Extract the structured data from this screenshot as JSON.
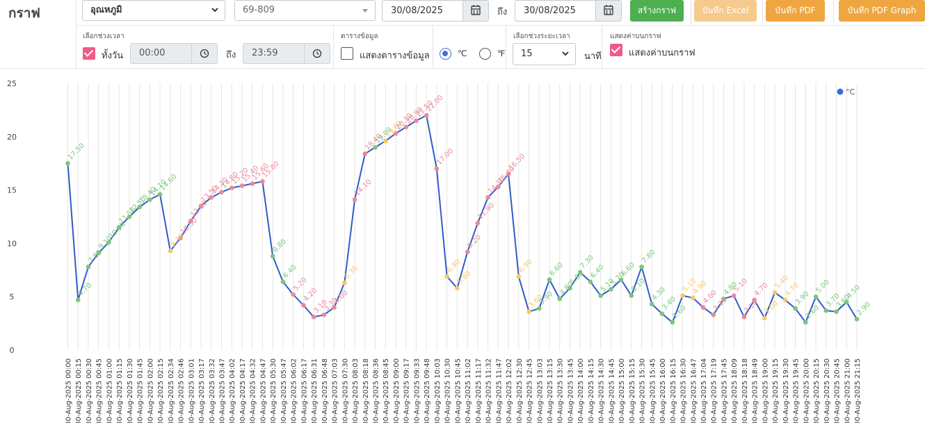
{
  "header": {
    "title": "กราฟ",
    "sensor_select": "อุณหภูมิ",
    "device_select": "69-809",
    "date_from": "30/08/2025",
    "to_label": "ถึง",
    "date_to": "30/08/2025",
    "btn_create": "สร้างกราฟ",
    "btn_excel": "บันทึก Excel",
    "btn_pdf": "บันทึก PDF",
    "btn_pdf_graph": "บันทึก PDF Graph"
  },
  "options": {
    "time_range_label": "เลือกช่วงเวลา",
    "all_day_label": "ทั้งวัน",
    "all_day_checked": true,
    "time_from": "00:00",
    "time_to_label": "ถึง",
    "time_to": "23:59",
    "table_section_label": "ตารางข้อมูล",
    "show_table_label": "แสดงตารางข้อมูล",
    "show_table_checked": false,
    "unit_c": "℃",
    "unit_f": "℉",
    "unit_selected": "C",
    "interval_label": "เลือกช่วงระยะเวลา",
    "interval_value": "15",
    "interval_unit": "นาที",
    "show_values_section_label": "แสดงค่าบนกราฟ",
    "show_values_label": "แสดงค่าบนกราฟ",
    "show_values_checked": true
  },
  "colors": {
    "line": "#2f5bc7",
    "legend_dot": "#2f6fe0",
    "green": "#7cc47f",
    "red": "#e88a98",
    "yellow": "#f5c96a",
    "grid": "#e5e5e5",
    "accent_pink": "#ef5b88"
  },
  "chart_data": {
    "type": "line",
    "ylim": [
      0,
      25
    ],
    "yticks": [
      "0",
      "5",
      "10",
      "15",
      "20",
      "25"
    ],
    "legend": "°C",
    "legend_position": "top-right",
    "grid": true,
    "x": [
      "30-Aug-2025 00:00",
      "30-Aug-2025 00:15",
      "30-Aug-2025 00:30",
      "30-Aug-2025 00:45",
      "30-Aug-2025 01:00",
      "30-Aug-2025 01:15",
      "30-Aug-2025 01:30",
      "30-Aug-2025 01:45",
      "30-Aug-2025 02:00",
      "30-Aug-2025 02:15",
      "30-Aug-2025 02:34",
      "30-Aug-2025 02:46",
      "30-Aug-2025 03:01",
      "30-Aug-2025 03:17",
      "30-Aug-2025 03:32",
      "30-Aug-2025 03:47",
      "30-Aug-2025 04:02",
      "30-Aug-2025 04:17",
      "30-Aug-2025 04:32",
      "30-Aug-2025 04:47",
      "30-Aug-2025 05:30",
      "30-Aug-2025 05:47",
      "30-Aug-2025 06:02",
      "30-Aug-2025 06:17",
      "30-Aug-2025 06:31",
      "30-Aug-2025 06:48",
      "30-Aug-2025 07:03",
      "30-Aug-2025 07:30",
      "30-Aug-2025 08:03",
      "30-Aug-2025 08:18",
      "30-Aug-2025 08:36",
      "30-Aug-2025 08:45",
      "30-Aug-2025 09:00",
      "30-Aug-2025 09:17",
      "30-Aug-2025 09:33",
      "30-Aug-2025 09:48",
      "30-Aug-2025 10:03",
      "30-Aug-2025 10:30",
      "30-Aug-2025 10:45",
      "30-Aug-2025 11:02",
      "30-Aug-2025 11:17",
      "30-Aug-2025 11:32",
      "30-Aug-2025 11:47",
      "30-Aug-2025 12:02",
      "30-Aug-2025 12:30",
      "30-Aug-2025 12:45",
      "30-Aug-2025 13:03",
      "30-Aug-2025 13:15",
      "30-Aug-2025 13:30",
      "30-Aug-2025 13:45",
      "30-Aug-2025 14:00",
      "30-Aug-2025 14:15",
      "30-Aug-2025 14:30",
      "30-Aug-2025 14:45",
      "30-Aug-2025 15:00",
      "30-Aug-2025 15:15",
      "30-Aug-2025 15:30",
      "30-Aug-2025 15:45",
      "30-Aug-2025 16:00",
      "30-Aug-2025 16:15",
      "30-Aug-2025 16:30",
      "30-Aug-2025 16:47",
      "30-Aug-2025 17:04",
      "30-Aug-2025 17:19",
      "30-Aug-2025 17:45",
      "30-Aug-2025 18:09",
      "30-Aug-2025 18:18",
      "30-Aug-2025 18:49",
      "30-Aug-2025 19:00",
      "30-Aug-2025 19:15",
      "30-Aug-2025 19:30",
      "30-Aug-2025 19:45",
      "30-Aug-2025 20:00",
      "30-Aug-2025 20:15",
      "30-Aug-2025 20:30",
      "30-Aug-2025 20:45",
      "30-Aug-2025 21:00",
      "30-Aug-2025 21:15"
    ],
    "series": [
      {
        "name": "°C",
        "values": [
          17.5,
          4.7,
          7.8,
          9.1,
          10.1,
          11.5,
          12.5,
          13.4,
          14.1,
          14.6,
          9.3,
          10.5,
          12.1,
          13.5,
          14.3,
          14.8,
          15.2,
          15.4,
          15.6,
          15.8,
          8.8,
          6.4,
          5.2,
          4.2,
          3.1,
          3.3,
          4.0,
          6.3,
          14.1,
          18.4,
          19.0,
          19.6,
          20.3,
          20.9,
          21.5,
          22.0,
          17.0,
          6.9,
          5.8,
          9.2,
          11.9,
          14.3,
          15.3,
          16.5,
          6.9,
          3.6,
          3.9,
          6.6,
          4.8,
          5.8,
          7.3,
          6.4,
          5.1,
          5.7,
          6.6,
          5.1,
          7.8,
          4.3,
          3.4,
          2.6,
          5.1,
          4.9,
          4.0,
          3.3,
          4.8,
          5.1,
          3.1,
          4.7,
          3.0,
          5.4,
          4.7,
          3.9,
          2.6,
          5.0,
          3.7,
          3.6,
          4.5,
          2.9
        ],
        "labels": [
          "17.50",
          "4.70",
          "7.80",
          "9.10",
          "10.10",
          "11.50",
          "12.50",
          "13.40",
          "14.10",
          "14.60",
          "9.30",
          "10.50",
          "12.10",
          "13.50",
          "14.30",
          "14.80",
          "15.20",
          "15.40",
          "15.60",
          "15.80",
          "8.80",
          "6.40",
          "5.20",
          "4.20",
          "3.10",
          "3.30",
          "4.00",
          "6.30",
          "14.10",
          "18.40",
          "19.00",
          "19.60",
          "20.30",
          "20.90",
          "21.50",
          "22.00",
          "17.00",
          "6.90",
          "5.80",
          "9.20",
          "11.90",
          "14.30",
          "15.30",
          "16.50",
          "6.90",
          "3.60",
          "3.90",
          "6.60",
          "4.80",
          "5.80",
          "7.30",
          "6.40",
          "5.10",
          "5.70",
          "6.60",
          "5.10",
          "7.80",
          "4.30",
          "3.40",
          "2.60",
          "5.10",
          "4.90",
          "4.00",
          "3.30",
          "4.80",
          "5.10",
          "3.10",
          "4.70",
          "3.00",
          "5.40",
          "4.70",
          "3.90",
          "2.60",
          "5.00",
          "3.70",
          "3.60",
          "4.50",
          "2.90"
        ],
        "colors": [
          "green",
          "green",
          "green",
          "green",
          "green",
          "green",
          "green",
          "green",
          "green",
          "green",
          "yellow",
          "red",
          "red",
          "red",
          "red",
          "red",
          "red",
          "red",
          "red",
          "red",
          "green",
          "green",
          "red",
          "red",
          "red",
          "red",
          "red",
          "yellow",
          "red",
          "red",
          "green",
          "yellow",
          "red",
          "red",
          "red",
          "red",
          "red",
          "yellow",
          "yellow",
          "red",
          "red",
          "red",
          "red",
          "red",
          "yellow",
          "yellow",
          "green",
          "green",
          "green",
          "green",
          "green",
          "green",
          "green",
          "green",
          "green",
          "green",
          "green",
          "green",
          "green",
          "green",
          "yellow",
          "yellow",
          "red",
          "red",
          "green",
          "red",
          "red",
          "red",
          "yellow",
          "yellow",
          "yellow",
          "green",
          "green",
          "green",
          "green",
          "green",
          "green",
          "green"
        ]
      }
    ]
  }
}
